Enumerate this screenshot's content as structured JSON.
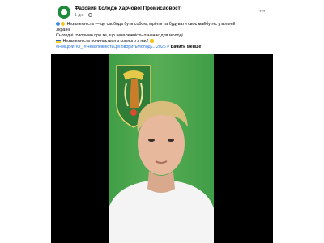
{
  "post": {
    "page_name": "Фаховий Коледж Харчової Промисловості",
    "time": "1 дн.",
    "lines": [
      "Незалежність — це свобода бути собою, мріяти та будувати своє майбутнє у вільній",
      "Україні.",
      "Сьогодні говоримо про те, що незалежність означає для молоді.",
      "Незалежність починається з кожного з нас!"
    ],
    "hashtags": "#НМЦВФПО_  #НезалежністьЦеГоворитьМолодь...2026 #",
    "see_more": "Бачити менше"
  },
  "colors": {
    "flag_green": "#3f9e46",
    "link_blue": "#216fdb",
    "muted_gray": "#65676b"
  },
  "icons": [
    "page-avatar-icon",
    "globe-icon",
    "more-options-icon",
    "heart-emoji-icon",
    "ukraine-flag-icon",
    "hand-emoji-icon"
  ]
}
